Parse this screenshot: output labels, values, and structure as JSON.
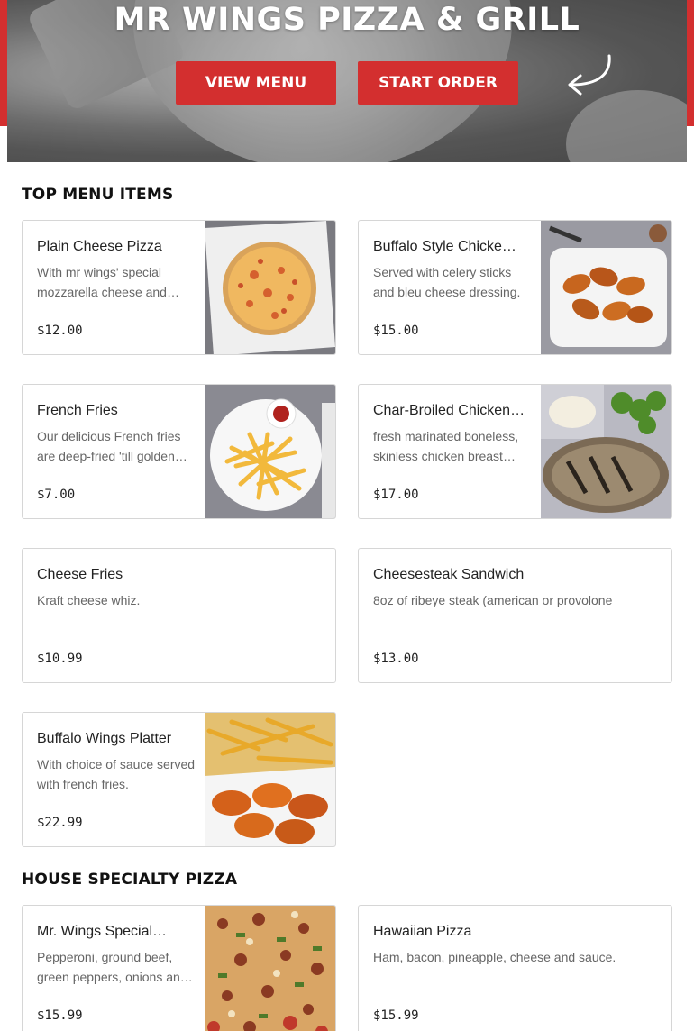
{
  "hero": {
    "title": "MR WINGS PIZZA & GRILL",
    "view_menu_label": "VIEW MENU",
    "start_order_label": "START ORDER",
    "arrow_icon": "curved-arrow-icon"
  },
  "colors": {
    "brand_red": "#d32f2f",
    "text_dark": "#222222",
    "text_muted": "#666666",
    "card_border": "#d6d6d6"
  },
  "sections": [
    {
      "title": "TOP MENU ITEMS",
      "items": [
        {
          "name": "Plain Cheese Pizza",
          "description": "With mr wings' special mozzarella cheese and…",
          "price": "$12.00",
          "image": "cheese-pizza-photo"
        },
        {
          "name": "Buffalo Style Chicke…",
          "description": "Served with celery sticks and bleu cheese dressing.",
          "price": "$15.00",
          "image": "buffalo-wings-photo"
        },
        {
          "name": "French Fries",
          "description": "Our delicious French fries are deep-fried 'till golden…",
          "price": "$7.00",
          "image": "french-fries-photo"
        },
        {
          "name": "Char-Broiled Chicken…",
          "description": "fresh marinated boneless, skinless chicken breast…",
          "price": "$17.00",
          "image": "grilled-chicken-photo"
        },
        {
          "name": "Cheese Fries",
          "description": "Kraft cheese whiz.",
          "price": "$10.99",
          "image": null
        },
        {
          "name": "Cheesesteak Sandwich",
          "description": "8oz of ribeye steak (american or provolone",
          "price": "$13.00",
          "image": null
        },
        {
          "name": "Buffalo Wings Platter",
          "description": "With choice of sauce served with french fries.",
          "price": "$22.99",
          "image": "wings-platter-photo"
        }
      ]
    },
    {
      "title": "HOUSE SPECIALTY PIZZA",
      "items": [
        {
          "name": "Mr. Wings Special…",
          "description": "Pepperoni, ground beef, green peppers, onions an…",
          "price": "$15.99",
          "image": "special-pizza-photo"
        },
        {
          "name": "Hawaiian Pizza",
          "description": "Ham, bacon, pineapple, cheese and sauce.",
          "price": "$15.99",
          "image": null
        }
      ]
    }
  ]
}
